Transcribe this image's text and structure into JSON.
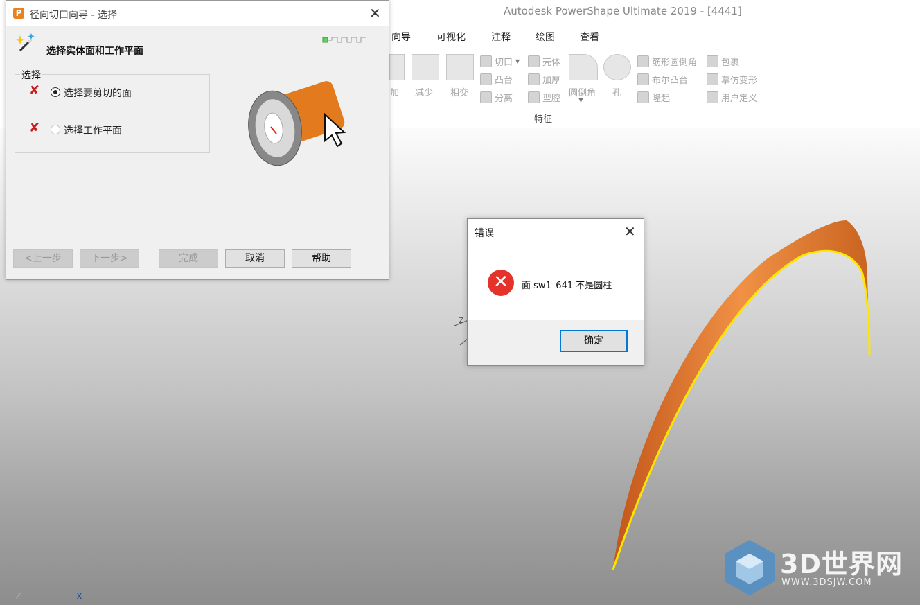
{
  "app": {
    "title": "Autodesk PowerShape Ultimate 2019 - [4441]"
  },
  "menu": {
    "items": [
      "向导",
      "可视化",
      "注释",
      "绘图",
      "查看"
    ]
  },
  "ribbon": {
    "big_buttons": [
      "加",
      "减少",
      "相交",
      "圆倒角",
      "孔"
    ],
    "small_buttons": [
      "切口",
      "凸台",
      "分离",
      "壳体",
      "加厚",
      "型腔",
      "筋形圆倒角",
      "布尔凸台",
      "隆起",
      "包裹",
      "摹仿变形",
      "用户定义"
    ],
    "group_label": "特征"
  },
  "wizard": {
    "title": "径向切口向导 - 选择",
    "heading": "选择实体面和工作平面",
    "group_label": "选择",
    "options": [
      {
        "label": "选择要剪切的面",
        "selected": true
      },
      {
        "label": "选择工作平面",
        "selected": false
      }
    ],
    "buttons": {
      "prev": "<上一步",
      "next": "下一步>",
      "finish": "完成",
      "cancel": "取消",
      "help": "帮助"
    }
  },
  "error_dialog": {
    "title": "错误",
    "message": "面 sw1_641 不是圆柱",
    "ok": "确定"
  },
  "viewport": {
    "axis_z": "Z",
    "axis_x": "X",
    "surface_color": "#e07a2c",
    "edge_color": "#ffe600"
  },
  "watermark": {
    "brand": "3D世界网",
    "url": "WWW.3DSJW.COM"
  },
  "colors": {
    "error": "#e5322b",
    "accent": "#0078d7",
    "brand_orange": "#e7821f"
  }
}
